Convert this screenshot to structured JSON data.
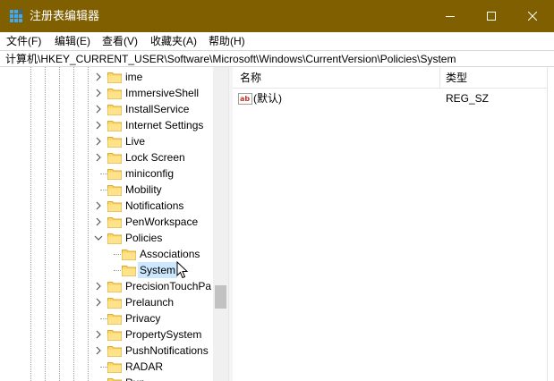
{
  "window": {
    "title": "注册表编辑器",
    "accent_color": "#7f5f00"
  },
  "menu": [
    "文件(F)",
    "编辑(E)",
    "查看(V)",
    "收藏夹(A)",
    "帮助(H)"
  ],
  "address": "计算机\\HKEY_CURRENT_USER\\Software\\Microsoft\\Windows\\CurrentVersion\\Policies\\System",
  "tree": {
    "items": [
      {
        "label": "ime",
        "expander": "collapsed"
      },
      {
        "label": "ImmersiveShell",
        "expander": "collapsed"
      },
      {
        "label": "InstallService",
        "expander": "collapsed"
      },
      {
        "label": "Internet Settings",
        "expander": "collapsed"
      },
      {
        "label": "Live",
        "expander": "collapsed"
      },
      {
        "label": "Lock Screen",
        "expander": "collapsed"
      },
      {
        "label": "miniconfig",
        "expander": "none"
      },
      {
        "label": "Mobility",
        "expander": "none"
      },
      {
        "label": "Notifications",
        "expander": "collapsed"
      },
      {
        "label": "PenWorkspace",
        "expander": "collapsed"
      },
      {
        "label": "Policies",
        "expander": "expanded"
      },
      {
        "label": "Associations",
        "expander": "none",
        "child": true
      },
      {
        "label": "System",
        "expander": "none",
        "child": true,
        "selected": true
      },
      {
        "label": "PrecisionTouchPa",
        "expander": "collapsed"
      },
      {
        "label": "Prelaunch",
        "expander": "collapsed"
      },
      {
        "label": "Privacy",
        "expander": "none"
      },
      {
        "label": "PropertySystem",
        "expander": "collapsed"
      },
      {
        "label": "PushNotifications",
        "expander": "collapsed"
      },
      {
        "label": "RADAR",
        "expander": "none"
      },
      {
        "label": "Run",
        "expander": "none"
      }
    ]
  },
  "list": {
    "columns": {
      "name": "名称",
      "type": "类型"
    },
    "rows": [
      {
        "icon": "string-value-icon",
        "name": "(默认)",
        "type": "REG_SZ"
      }
    ]
  }
}
